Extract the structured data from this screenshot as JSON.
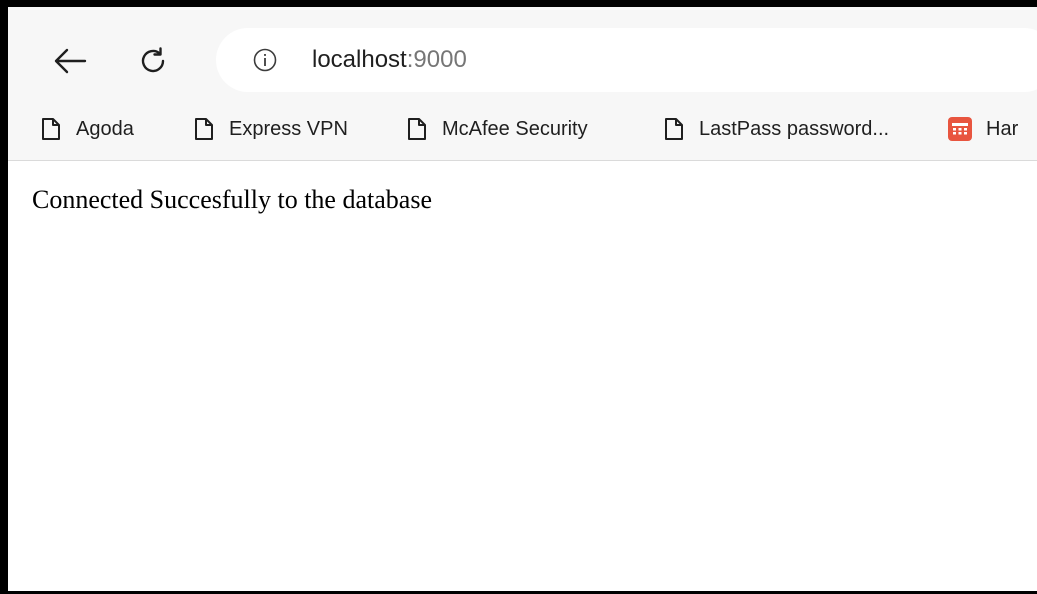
{
  "address_bar": {
    "host": "localhost",
    "port": ":9000"
  },
  "bookmarks": [
    {
      "label": "Agoda",
      "icon": "page-icon"
    },
    {
      "label": "Express VPN",
      "icon": "page-icon"
    },
    {
      "label": "McAfee Security",
      "icon": "page-icon"
    },
    {
      "label": "LastPass password...",
      "icon": "page-icon"
    },
    {
      "label": "Har",
      "icon": "app-icon"
    }
  ],
  "page": {
    "message": "Connected Succesfully to the database"
  },
  "colors": {
    "toolbar_bg": "#f7f7f7",
    "frame_border": "#000000",
    "app_icon_bg": "#e8553f"
  }
}
